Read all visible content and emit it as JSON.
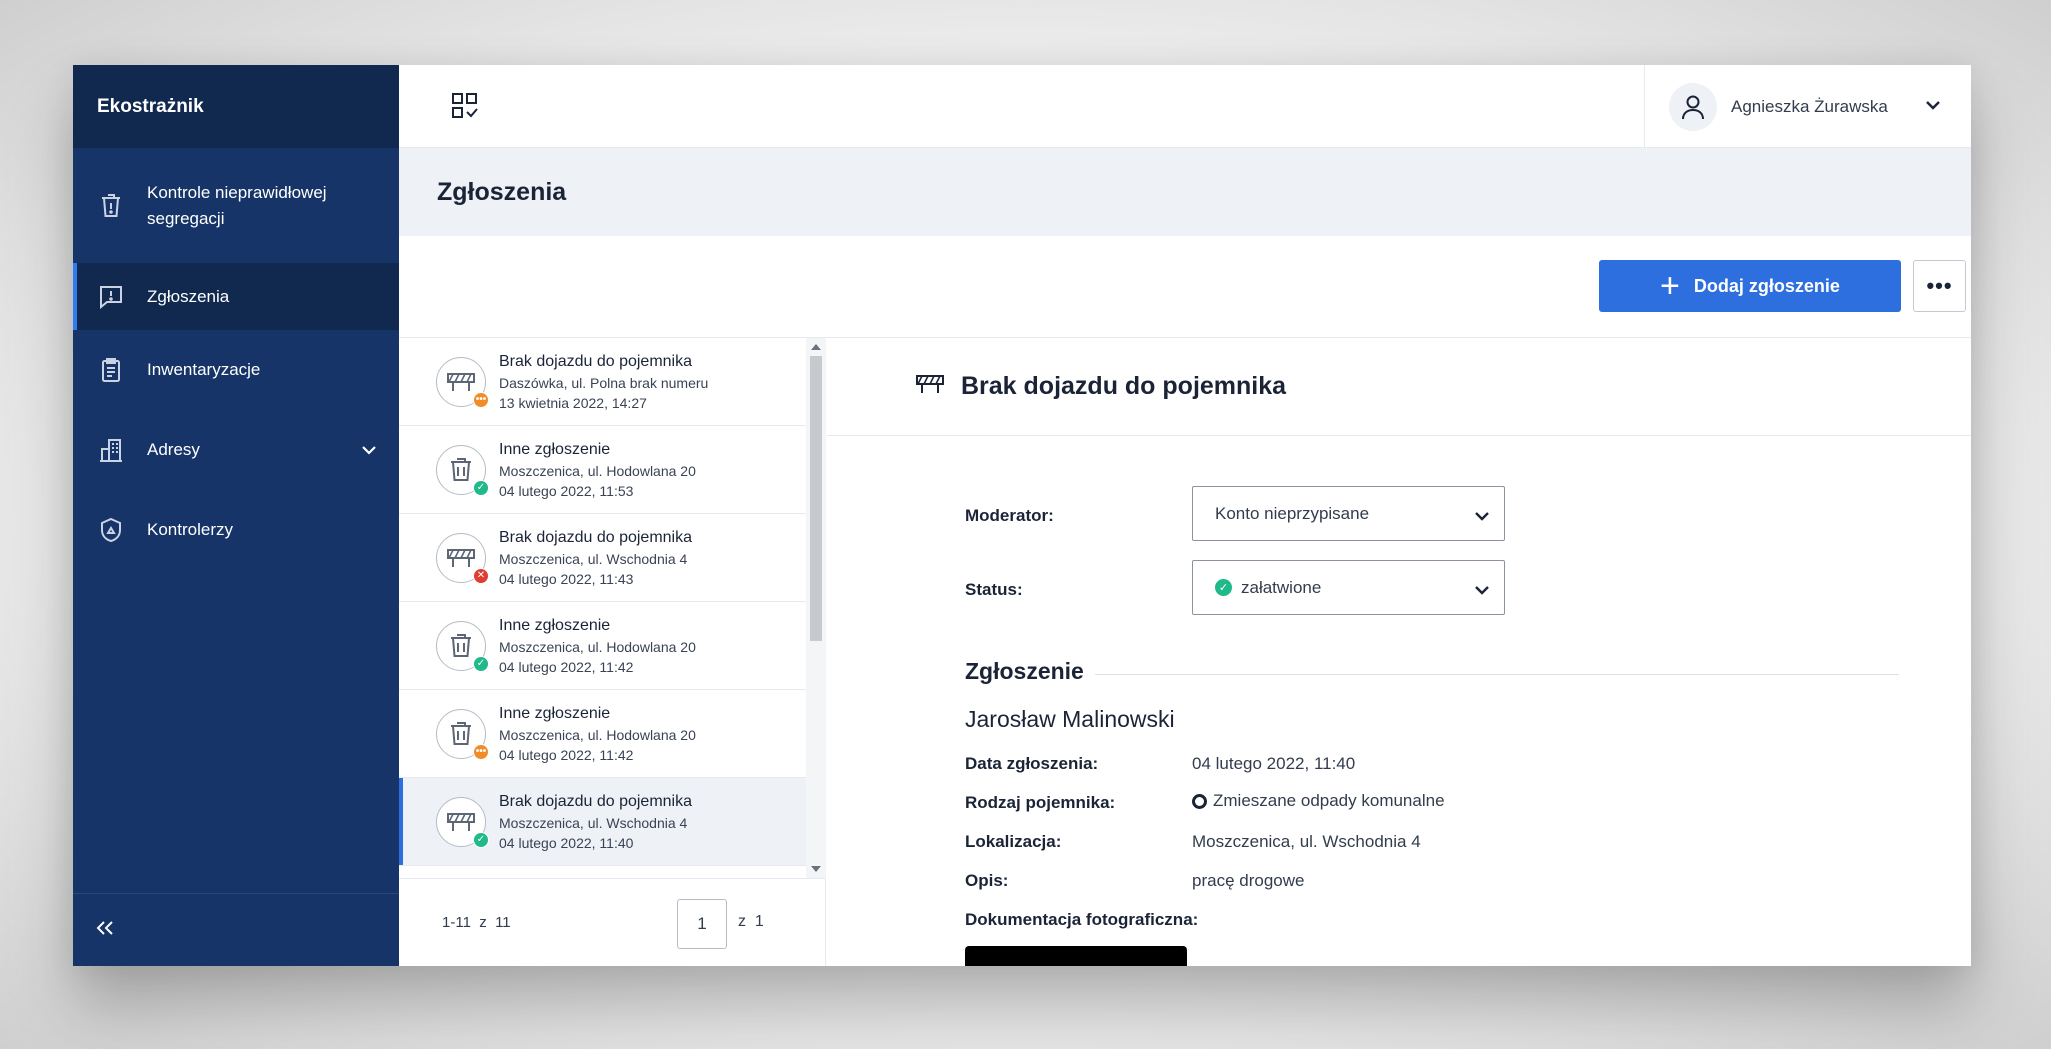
{
  "app": {
    "title": "Ekostrażnik"
  },
  "sidebar": {
    "items": [
      {
        "label": "Kontrole nieprawidłowej segregacji",
        "icon": "bin-icon"
      },
      {
        "label": "Zgłoszenia",
        "icon": "report-icon",
        "active": true
      },
      {
        "label": "Inwentaryzacje",
        "icon": "clipboard-icon"
      },
      {
        "label": "Adresy",
        "icon": "building-icon",
        "expandable": true
      },
      {
        "label": "Kontrolerzy",
        "icon": "shield-icon"
      }
    ],
    "collapse_icon": "double-chevron-left-icon"
  },
  "topbar": {
    "apps_icon": "apps-grid-icon",
    "user_name": "Agnieszka Żurawska"
  },
  "page": {
    "title": "Zgłoszenia",
    "add_button_label": "Dodaj zgłoszenie",
    "more_button_label": "•••"
  },
  "list": {
    "items": [
      {
        "title": "Brak dojazdu do pojemnika",
        "address": "Daszówka, ul. Polna brak numeru",
        "date": "13 kwietnia 2022, 14:27",
        "type": "barrier",
        "status": "pending",
        "badge": "•••"
      },
      {
        "title": "Inne zgłoszenie",
        "address": "Moszczenica, ul. Hodowlana 20",
        "date": "04 lutego 2022, 11:53",
        "type": "bin",
        "status": "done",
        "badge": "✓"
      },
      {
        "title": "Brak dojazdu do pojemnika",
        "address": "Moszczenica, ul. Wschodnia 4",
        "date": "04 lutego 2022, 11:43",
        "type": "barrier",
        "status": "rejected",
        "badge": "✕"
      },
      {
        "title": "Inne zgłoszenie",
        "address": "Moszczenica, ul. Hodowlana 20",
        "date": "04 lutego 2022, 11:42",
        "type": "bin",
        "status": "done",
        "badge": "✓"
      },
      {
        "title": "Inne zgłoszenie",
        "address": "Moszczenica, ul. Hodowlana 20",
        "date": "04 lutego 2022, 11:42",
        "type": "bin",
        "status": "pending",
        "badge": "•••"
      },
      {
        "title": "Brak dojazdu do pojemnika",
        "address": "Moszczenica, ul. Wschodnia 4",
        "date": "04 lutego 2022, 11:40",
        "type": "barrier",
        "status": "done",
        "badge": "✓",
        "selected": true
      }
    ],
    "pager": {
      "range": "1-11  z  11",
      "page": "1",
      "of": "z  1"
    }
  },
  "detail": {
    "title": "Brak dojazdu do pojemnika",
    "moderator_label": "Moderator:",
    "moderator_value": "Konto nieprzypisane",
    "status_label": "Status:",
    "status_value": "załatwione",
    "section_title": "Zgłoszenie",
    "reporter": "Jarosław Malinowski",
    "rows": [
      {
        "label": "Data zgłoszenia:",
        "value": "04 lutego 2022, 11:40"
      },
      {
        "label": "Rodzaj pojemnika:",
        "value": "Zmieszane odpady komunalne"
      },
      {
        "label": "Lokalizacja:",
        "value": "Moszczenica, ul. Wschodnia 4"
      },
      {
        "label": "Opis:",
        "value": "pracę drogowe"
      }
    ],
    "photo_label": "Dokumentacja fotograficzna:"
  },
  "colors": {
    "sidebar": "#163467",
    "sidebar_dark": "#11294f",
    "primary": "#2e6fe0",
    "status_done": "#1fb98a",
    "status_pending": "#f28c28",
    "status_rejected": "#e03c31"
  }
}
